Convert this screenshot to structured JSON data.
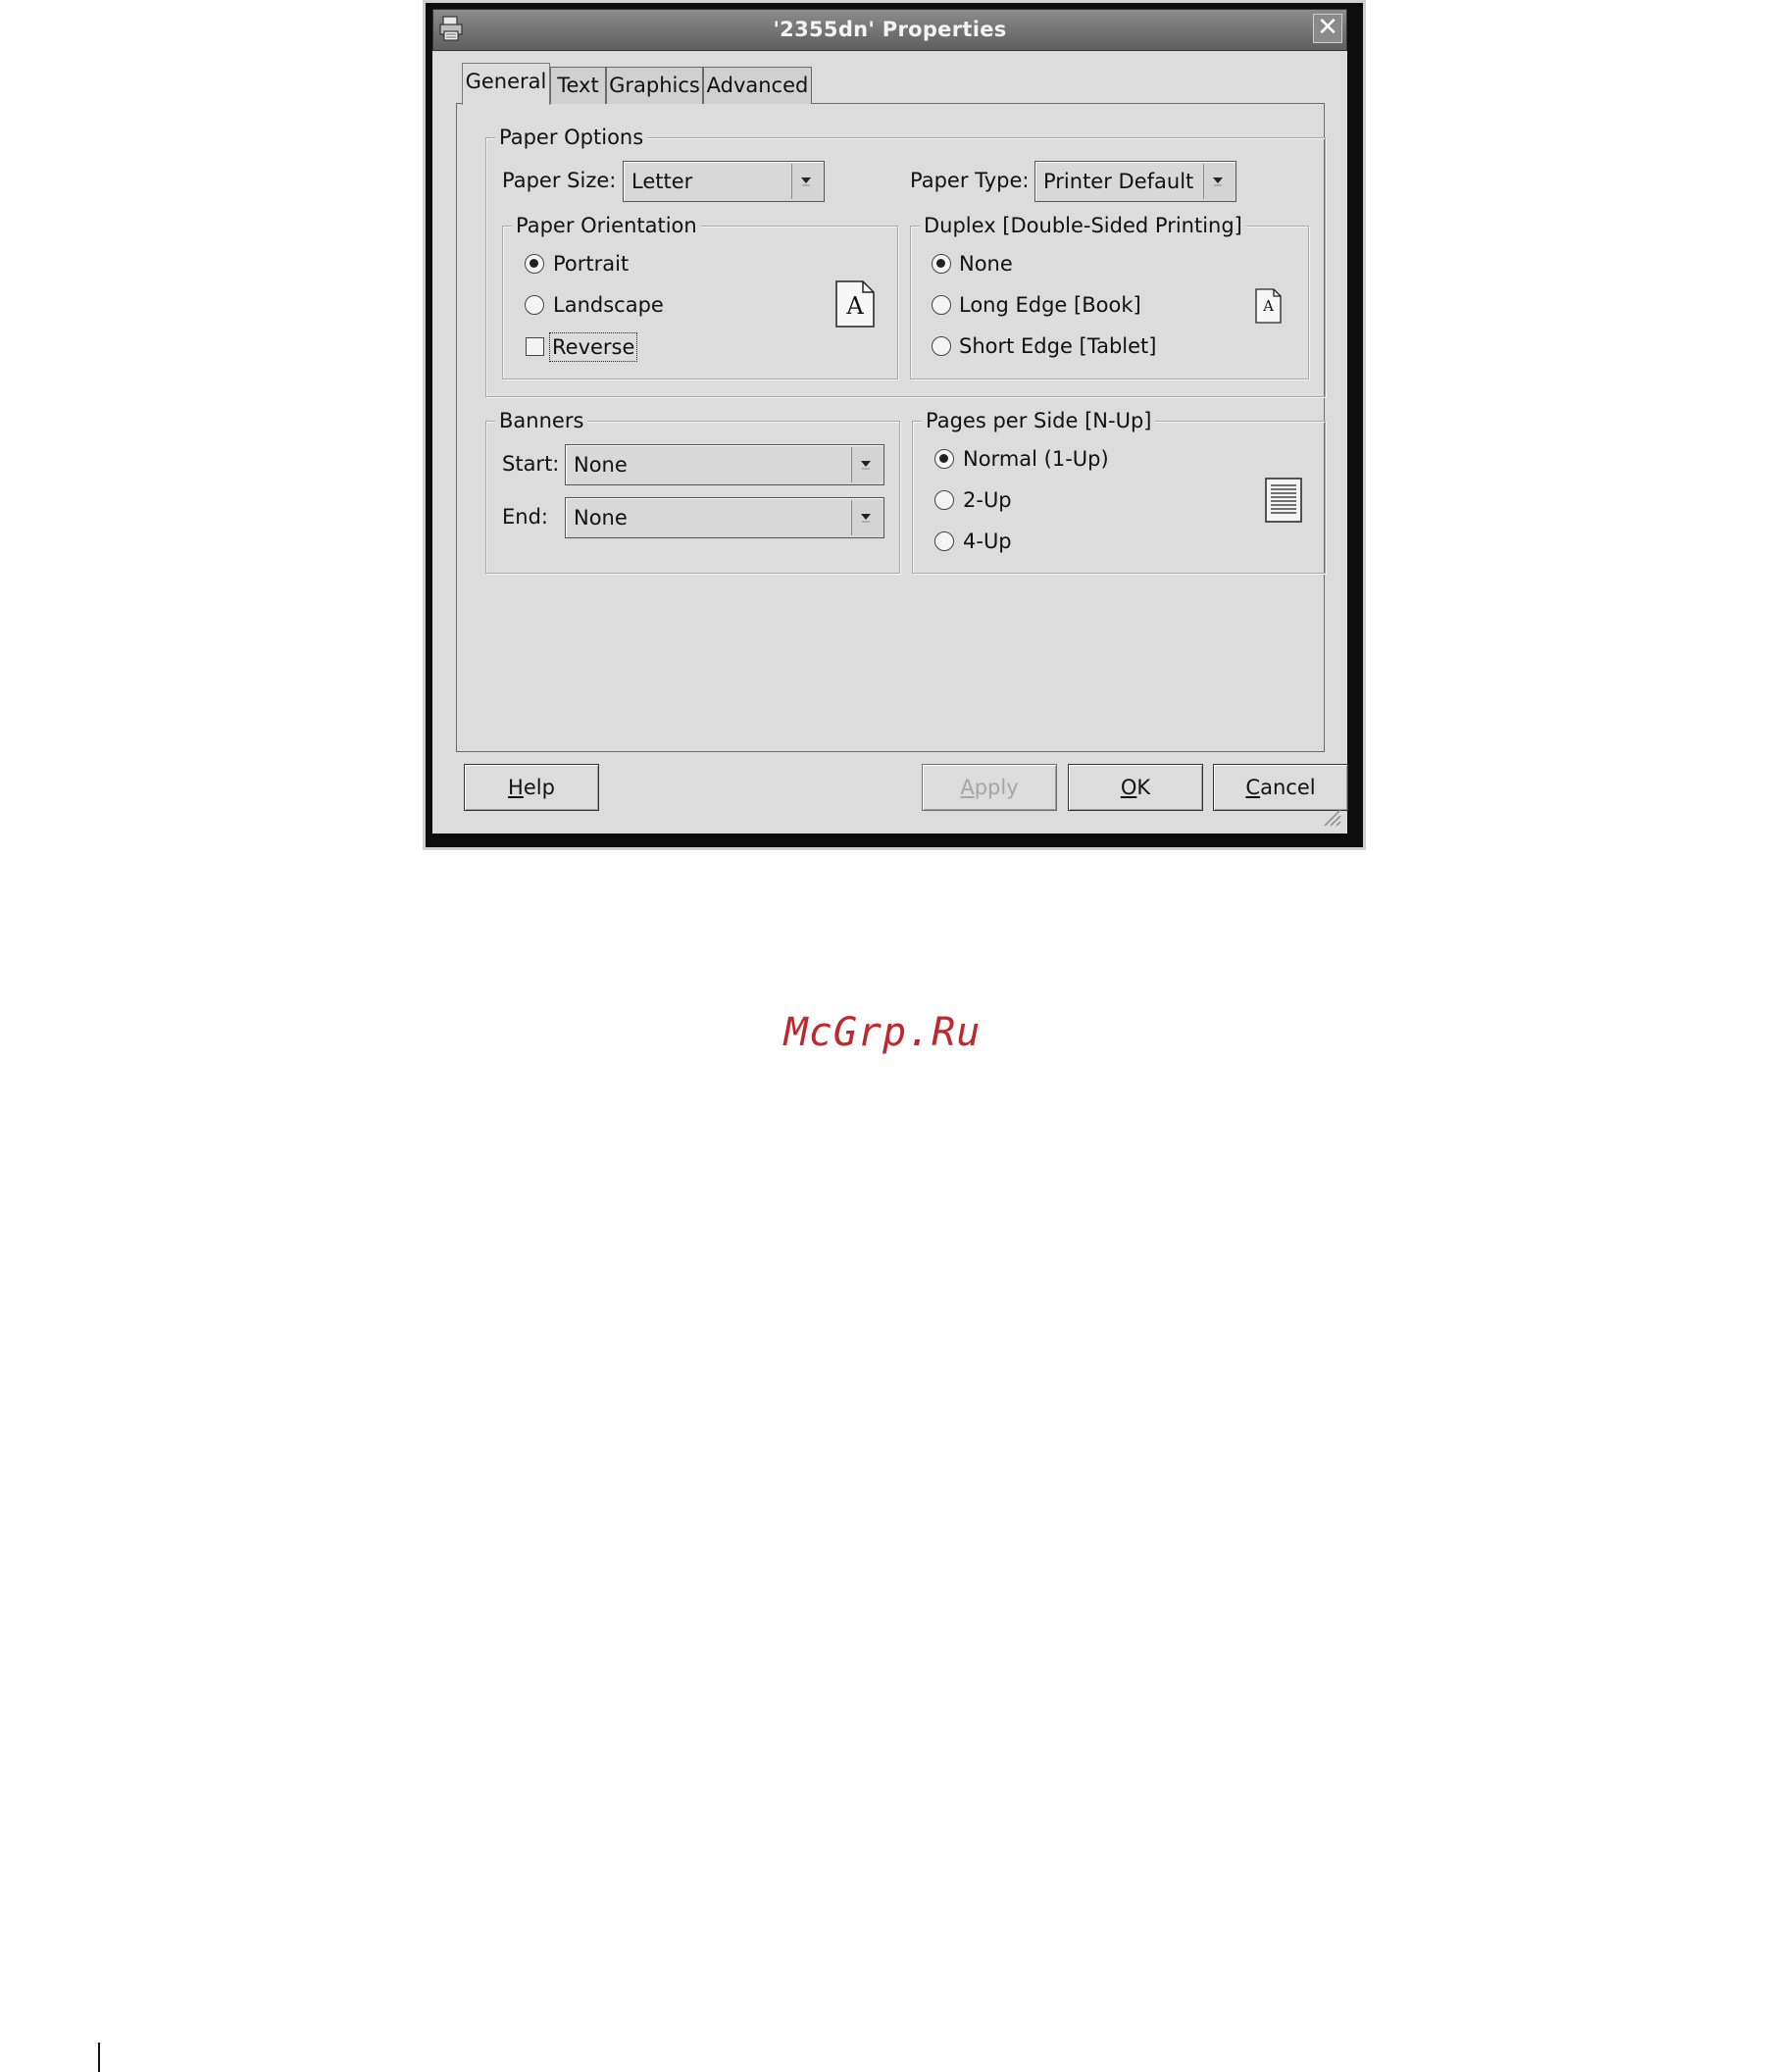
{
  "window": {
    "title": "'2355dn' Properties",
    "close_glyph": "✕",
    "icon": "printer-icon"
  },
  "tabs": [
    {
      "label": "General",
      "active": true
    },
    {
      "label": "Text",
      "active": false
    },
    {
      "label": "Graphics",
      "active": false
    },
    {
      "label": "Advanced",
      "active": false
    }
  ],
  "paper_options": {
    "legend": "Paper Options",
    "paper_size_label": "Paper Size:",
    "paper_size_value": "Letter",
    "paper_type_label": "Paper Type:",
    "paper_type_value": "Printer Default"
  },
  "orientation": {
    "legend": "Paper Orientation",
    "options": [
      {
        "label": "Portrait",
        "selected": true
      },
      {
        "label": "Landscape",
        "selected": false
      }
    ],
    "reverse_label": "Reverse",
    "reverse_checked": false,
    "preview_glyph": "A"
  },
  "duplex": {
    "legend": "Duplex [Double-Sided Printing]",
    "options": [
      {
        "label": "None",
        "selected": true
      },
      {
        "label": "Long Edge [Book]",
        "selected": false
      },
      {
        "label": "Short Edge [Tablet]",
        "selected": false
      }
    ],
    "preview_glyph": "A"
  },
  "banners": {
    "legend": "Banners",
    "start_label": "Start:",
    "start_value": "None",
    "end_label": "End:",
    "end_value": "None"
  },
  "nup": {
    "legend": "Pages per Side [N-Up]",
    "options": [
      {
        "label": "Normal (1-Up)",
        "selected": true
      },
      {
        "label": "2-Up",
        "selected": false
      },
      {
        "label": "4-Up",
        "selected": false
      }
    ]
  },
  "buttons": {
    "help": {
      "mnemonic": "H",
      "rest": "elp"
    },
    "apply": {
      "mnemonic": "A",
      "rest": "pply",
      "disabled": true
    },
    "ok": {
      "mnemonic": "O",
      "rest": "K"
    },
    "cancel": {
      "mnemonic": "C",
      "rest": "ancel"
    }
  },
  "watermark": "McGrp.Ru",
  "colors": {
    "window_bg": "#dcdcdc",
    "titlebar": "#6e6e6e",
    "watermark": "#c0262c"
  }
}
